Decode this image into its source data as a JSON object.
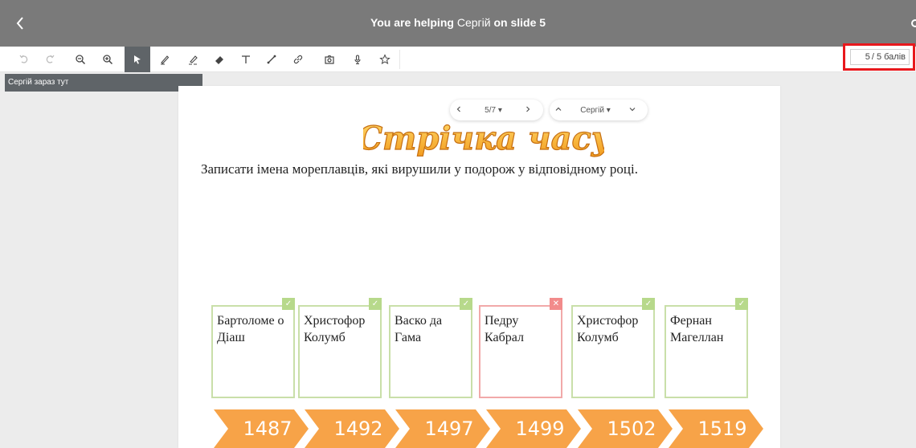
{
  "banner": {
    "prefix": "You are helping",
    "student": "Сергій",
    "suffix": "on slide 5"
  },
  "toolbar": {
    "tools": [
      "undo-icon",
      "redo-icon",
      "zoom-out-icon",
      "zoom-in-icon",
      "pointer-icon",
      "pen-icon",
      "highlighter-icon",
      "eraser-icon",
      "text-icon",
      "line-icon",
      "link-icon",
      "camera-icon",
      "microphone-icon",
      "star-icon"
    ],
    "active_tool": "pointer-icon"
  },
  "score": {
    "value": "5",
    "suffix": "/ 5 балів"
  },
  "here_tooltip": "Сергій зараз тут",
  "slide_nav": {
    "position": "5/7 ▾"
  },
  "student_nav": {
    "name": "Сергій ▾"
  },
  "slide": {
    "logo_text": "Стрічка часу",
    "instruction": "Записати імена мореплавців, які вирушили у подорож у відповідному році.",
    "cards": [
      {
        "text": "Бартоломе о Діаш",
        "status": "correct"
      },
      {
        "text": "Христофор Колумб",
        "status": "correct"
      },
      {
        "text": "Васко да Гама",
        "status": "correct"
      },
      {
        "text": "Педру Кабрал",
        "status": "wrong"
      },
      {
        "text": "Христофор Колумб",
        "status": "correct"
      },
      {
        "text": "Фернан Магеллан",
        "status": "correct"
      }
    ],
    "years": [
      "1487",
      "1492",
      "1497",
      "1499",
      "1502",
      "1519"
    ]
  },
  "colors": {
    "banner": "#7a7a7a",
    "correct": "#b7d98b",
    "wrong": "#f28b8b",
    "timeline": "#f7a348",
    "score_outline": "#e8181c"
  }
}
